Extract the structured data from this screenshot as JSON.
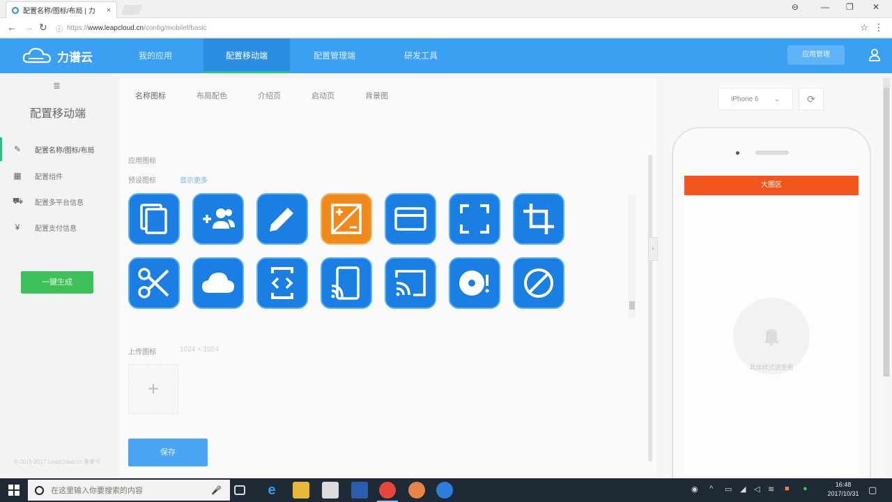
{
  "browser": {
    "tab_title": "配置名称/图标/布局 | 力",
    "tab_close": "×",
    "url_scheme": "https://",
    "url_host": "www.leapcloud.cn",
    "url_path": "/config/mobilef/basic",
    "window_controls": [
      "⊖",
      "—",
      "❐",
      "✕"
    ]
  },
  "header": {
    "brand": "力谱云",
    "nav": [
      {
        "label": "我的应用",
        "active": false
      },
      {
        "label": "配置移动端",
        "active": true
      },
      {
        "label": "配置管理端",
        "active": false
      },
      {
        "label": "研发工具",
        "active": false
      }
    ],
    "action_button": "应用管理"
  },
  "sidebar": {
    "top_icon": "≣",
    "title": "配置移动端",
    "items": [
      {
        "icon": "✎",
        "icon_name": "pencil-icon",
        "label": "配置名称/图标/布局",
        "active": true
      },
      {
        "icon": "▦",
        "icon_name": "modules-icon",
        "label": "配置组件",
        "active": false
      },
      {
        "icon": "⛟",
        "icon_name": "platform-icon",
        "label": "配置多平台信息",
        "active": false
      },
      {
        "icon": "¥",
        "icon_name": "yen-icon",
        "label": "配置支付信息",
        "active": false
      }
    ],
    "generate_button": "一键生成",
    "footer": "© 2015-2017 LeapCloud.cn 备案号"
  },
  "main": {
    "subtabs": [
      {
        "label": "名称图标",
        "active": true
      },
      {
        "label": "布局配色",
        "active": false
      },
      {
        "label": "介绍页",
        "active": false
      },
      {
        "label": "启动页",
        "active": false
      },
      {
        "label": "背景图",
        "active": false
      }
    ],
    "app_icon_label": "应用图标",
    "preset_label": "预设图标",
    "more_link": "显示更多",
    "icons": [
      "copy-icon",
      "group-add-icon",
      "pencil-icon",
      "exposure-icon",
      "card-icon",
      "fullscreen-icon",
      "crop-icon",
      "scissors-icon",
      "cloud-icon",
      "code-phone-icon",
      "cast-phone-icon",
      "cast-icon",
      "disc-alert-icon",
      "block-icon"
    ],
    "selected_icon_index": 3,
    "upload_label": "上传图标",
    "upload_size": "1024 × 1024",
    "upload_plus": "+",
    "save_button": "保存",
    "collapse_handle": "›"
  },
  "preview": {
    "device": "iPhone 6",
    "device_caret": "⌄",
    "refresh": "⟳",
    "banner_text": "大图区",
    "placeholder_text": "具体样式请查看"
  },
  "taskbar": {
    "search_placeholder": "在这里输入你要搜索的内容",
    "mic": "🎤",
    "time": "16:48",
    "date": "2017/10/31"
  },
  "colors": {
    "header_blue": "#3b9ff2",
    "icon_blue": "#1a7ee3",
    "icon_selected_orange": "#f08a1c",
    "accent_green": "#26c281",
    "banner_orange": "#f0561d"
  }
}
